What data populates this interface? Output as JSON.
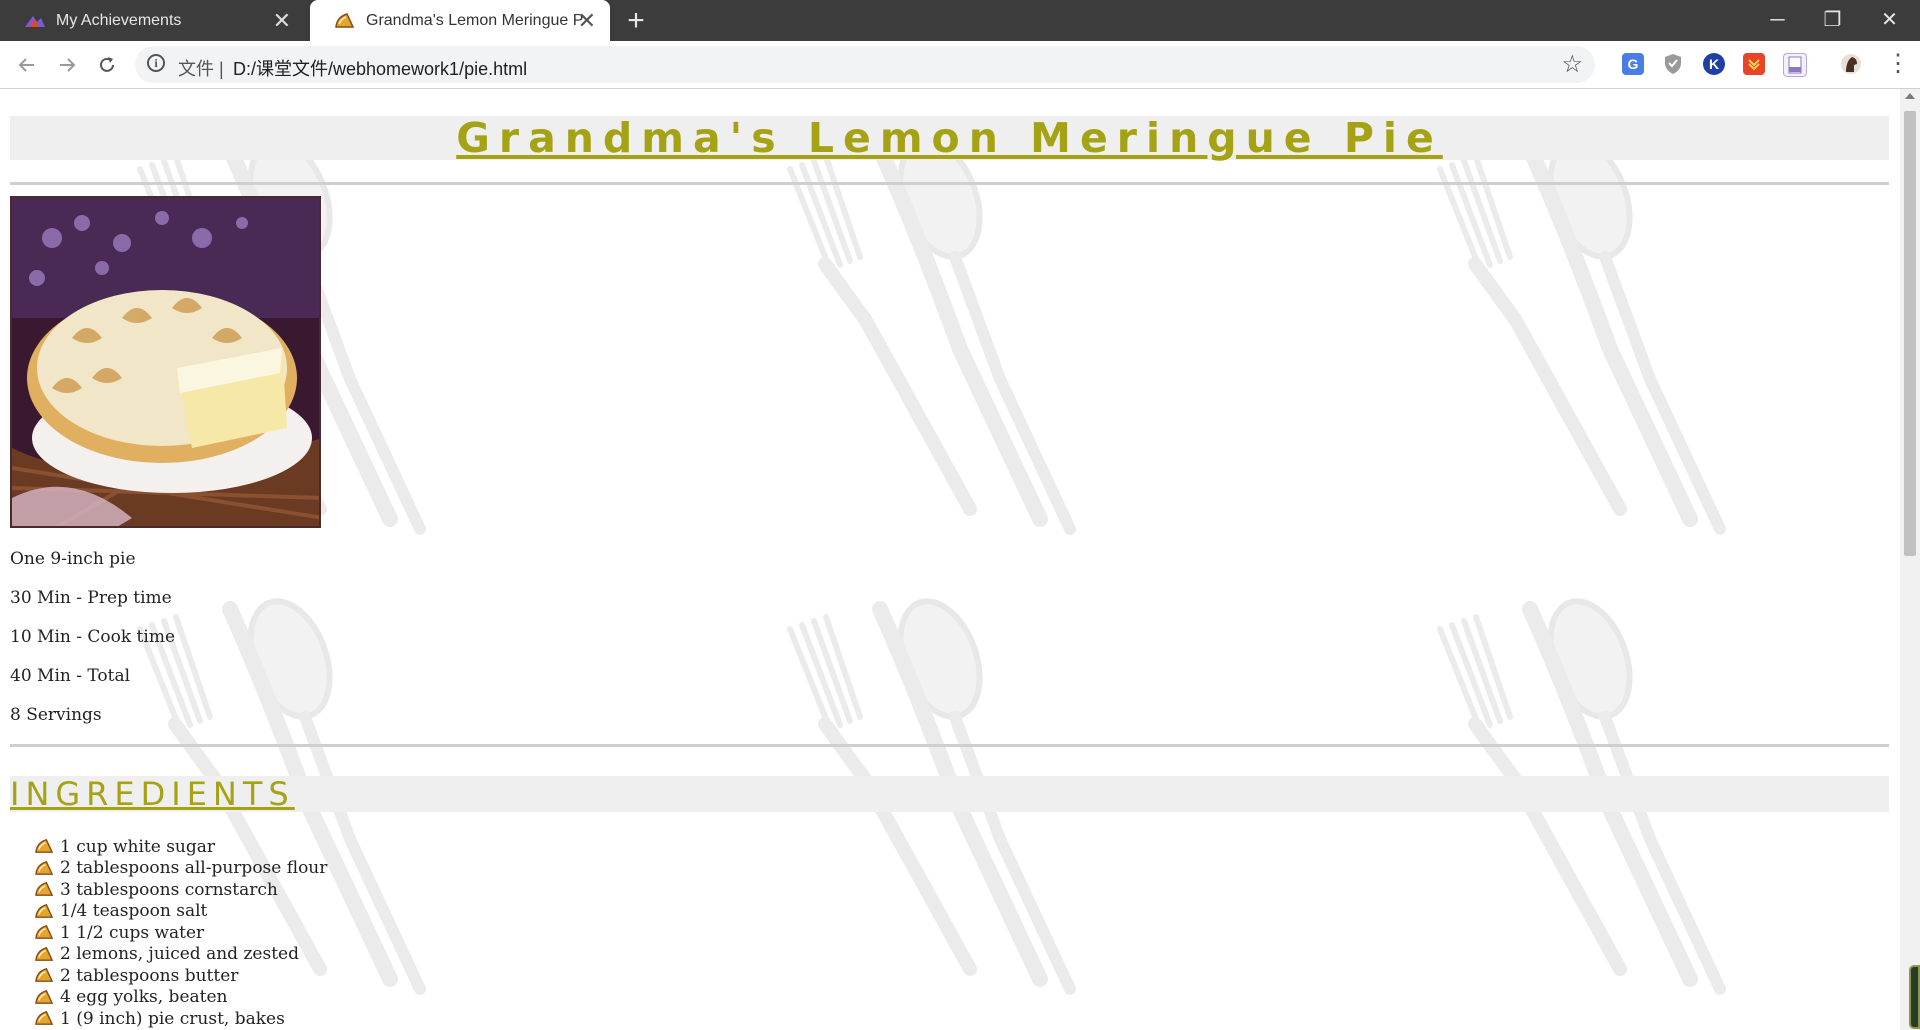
{
  "browser": {
    "tabs": [
      {
        "title": "My Achievements",
        "active": false,
        "favicon": "achievements-logo-icon"
      },
      {
        "title": "Grandma's Lemon Meringue P",
        "active": true,
        "favicon": "pie-icon"
      }
    ],
    "close_glyph": "✕",
    "new_tab_glyph": "+",
    "window_controls": {
      "minimize": "─",
      "restore": "❐",
      "close": "✕"
    },
    "address": {
      "scheme_label": "文件",
      "separator": "|",
      "url": "D:/课堂文件/webhomework1/pie.html",
      "info_glyph": "i"
    },
    "bookmark_glyph": "☆",
    "extensions": [
      {
        "name": "google-translate-icon",
        "label": "G",
        "color": "#4a7de8"
      },
      {
        "name": "shield-extension-icon",
        "label": "",
        "color": "#888888"
      },
      {
        "name": "k-extension-icon",
        "label": "K",
        "color": "#1f3fa8"
      },
      {
        "name": "download-extension-icon",
        "label": "",
        "color": "#e8442a"
      },
      {
        "name": "pdf-extension-icon",
        "label": "",
        "color": "#8a7abf"
      },
      {
        "name": "horse-avatar-icon",
        "label": "",
        "color": "#4a3020"
      }
    ],
    "menu_glyph": "⋮"
  },
  "page": {
    "title": "Grandma's Lemon Meringue Pie",
    "info": [
      "One 9-inch pie",
      "30 Min - Prep time",
      "10 Min - Cook time",
      "40 Min - Total",
      "8 Servings"
    ],
    "ingredients_heading": "INGREDIENTS",
    "ingredients": [
      "1 cup white sugar",
      "2 tablespoons all-purpose flour",
      "3 tablespoons cornstarch",
      "1/4 teaspoon salt",
      "1 1/2 cups water",
      "2 lemons, juiced and zested",
      "2 tablespoons butter",
      "4 egg yolks, beaten",
      "1 (9 inch) pie crust, bakes"
    ]
  },
  "colors": {
    "title_accent": "#a5a315",
    "band_background": "#efefef",
    "tabbar": "#3c3c3c"
  }
}
